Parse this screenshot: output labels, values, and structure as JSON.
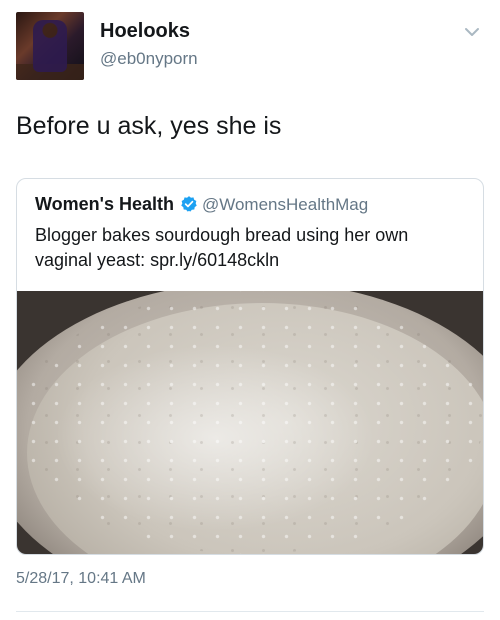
{
  "tweet": {
    "author_name": "Hoelooks",
    "author_handle": "@eb0nyporn",
    "text": "Before u ask, yes she is",
    "timestamp": "5/28/17, 10:41 AM",
    "menu_icon": "chevron-down-icon"
  },
  "quote": {
    "author_name": "Women's Health",
    "author_handle": "@WomensHealthMag",
    "verified_icon": "verified-badge-icon",
    "text": "Blogger bakes sourdough bread using her own vaginal yeast: spr.ly/60148ckln"
  },
  "colors": {
    "primary_text": "#14171a",
    "secondary_text": "#657786",
    "verified_blue": "#1da1f2",
    "border": "#d6dde3"
  }
}
